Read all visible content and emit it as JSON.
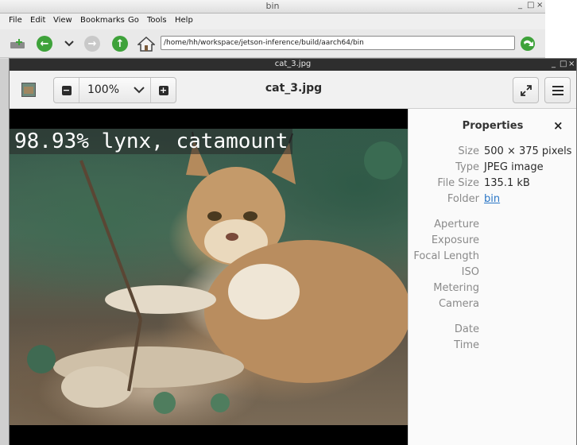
{
  "file_manager": {
    "title": "bin",
    "window_controls": [
      "_",
      "□",
      "×"
    ],
    "menu": [
      "File",
      "Edit",
      "View",
      "Bookmarks",
      "Go",
      "Tools",
      "Help"
    ],
    "location": "/home/hh/workspace/jetson-inference/build/aarch64/bin"
  },
  "viewer": {
    "window_title": "cat_3.jpg",
    "window_controls": [
      "_",
      "□",
      "×"
    ],
    "zoom_value": "100%",
    "header_title": "cat_3.jpg",
    "image_label": "98.93% lynx, catamount"
  },
  "properties": {
    "title": "Properties",
    "close_glyph": "×",
    "rows": [
      {
        "key": "Size",
        "value": "500 × 375 pixels"
      },
      {
        "key": "Type",
        "value": "JPEG image"
      },
      {
        "key": "File Size",
        "value": "135.1 kB"
      },
      {
        "key": "Folder",
        "value": "bin"
      },
      {
        "key": "Aperture",
        "value": ""
      },
      {
        "key": "Exposure",
        "value": ""
      },
      {
        "key": "Focal Length",
        "value": ""
      },
      {
        "key": "ISO",
        "value": ""
      },
      {
        "key": "Metering",
        "value": ""
      },
      {
        "key": "Camera",
        "value": ""
      },
      {
        "key": "Date",
        "value": ""
      },
      {
        "key": "Time",
        "value": ""
      }
    ]
  },
  "colors": {
    "accent_green": "#3ea23a",
    "link_blue": "#2a76c6",
    "viewer_titlebar": "#2e2e2e"
  },
  "icons": [
    "add-tab-icon",
    "back-icon",
    "chevron-down-icon",
    "forward-icon",
    "up-icon",
    "home-icon",
    "go-icon",
    "image-thumbnail-icon",
    "zoom-out-icon",
    "zoom-in-icon",
    "fullscreen-icon",
    "hamburger-menu-icon",
    "close-icon"
  ]
}
